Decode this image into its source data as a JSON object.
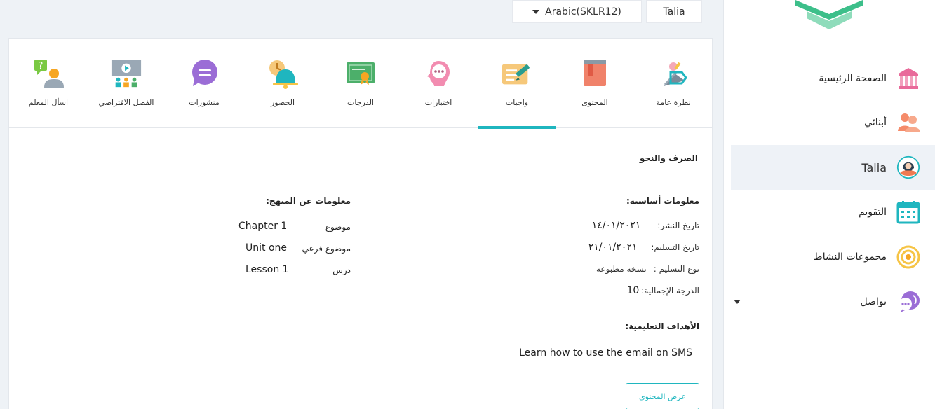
{
  "topbar": {
    "course_label": "Arabic(SKLR12)",
    "child_label": "Talia"
  },
  "tabs": [
    {
      "label": "نظرة عامة",
      "icon": "overview-icon"
    },
    {
      "label": "المحتوى",
      "icon": "book-icon"
    },
    {
      "label": "واجبات",
      "icon": "homework-icon",
      "active": true
    },
    {
      "label": "اختبارات",
      "icon": "quiz-icon"
    },
    {
      "label": "الدرجات",
      "icon": "certificate-icon"
    },
    {
      "label": "الحضور",
      "icon": "bell-clock-icon"
    },
    {
      "label": "منشورات",
      "icon": "chat-bubble-icon"
    },
    {
      "label": "الفصل الافتراضي",
      "icon": "virtual-class-icon"
    },
    {
      "label": "اسأل المعلم",
      "icon": "ask-teacher-icon"
    }
  ],
  "assignment": {
    "subject": "الصرف والنحو",
    "basic_info_title": "معلومات أساسية:",
    "publish_date_label": "تاريخ النشر:",
    "publish_date": "١٤/٠١/٢٠٢١",
    "due_date_label": "تاريخ التسليم:",
    "due_date": "٢١/٠١/٢٠٢١",
    "delivery_type_label": "نوع التسليم :",
    "delivery_type": "نسخة مطبوعة",
    "total_grade_label": "الدرجة الإجمالية:",
    "total_grade": "10",
    "curriculum_title": "معلومات عن المنهج:",
    "topic_label": "موضوع",
    "topic": "Chapter 1",
    "subtopic_label": "موضوع فرعي",
    "subtopic": "Unit one",
    "lesson_label": "درس",
    "lesson": "Lesson 1",
    "goals_title": "الأهداف التعليمية:",
    "goal": "Learn how to use the email on SMS",
    "view_content_button": "عرض المحتوى"
  },
  "sidebar": {
    "items": [
      {
        "label": "الصفحة الرئيسية",
        "icon": "school-building-icon"
      },
      {
        "label": "أبنائي",
        "icon": "children-icon"
      },
      {
        "label": "Talia",
        "icon": "student-avatar-icon",
        "active": true
      },
      {
        "label": "التقويم",
        "icon": "calendar-icon"
      },
      {
        "label": "مجموعات النشاط",
        "icon": "activity-groups-icon"
      },
      {
        "label": "تواصل",
        "icon": "communication-icon"
      }
    ]
  },
  "colors": {
    "accent": "#1fb6bf",
    "active_nav_bg": "#eef2f7"
  }
}
